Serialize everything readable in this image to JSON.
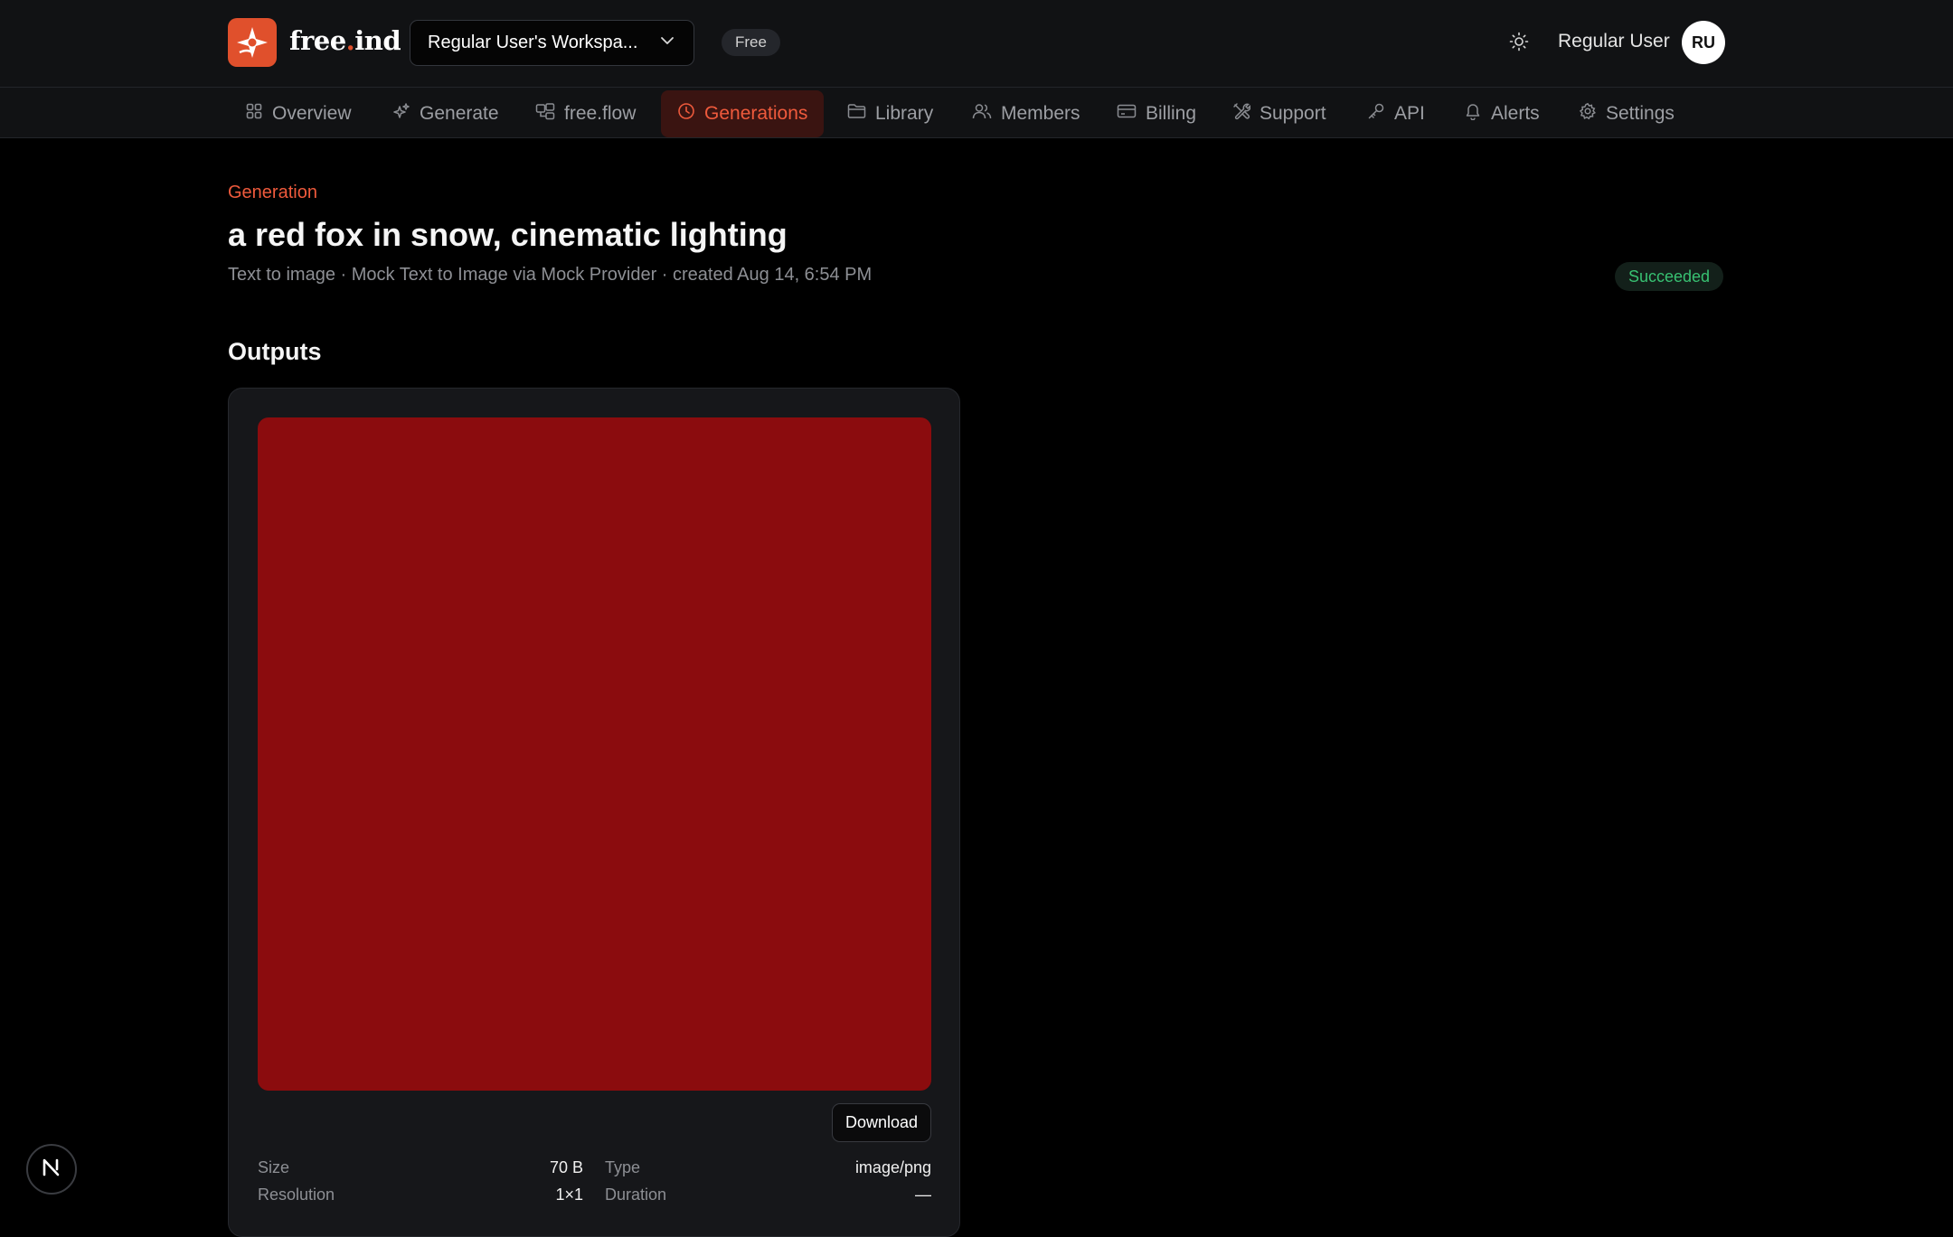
{
  "brand": {
    "name_main": "free",
    "name_dot": ".",
    "name_tail": "ind",
    "accent": "#e0502c"
  },
  "header": {
    "workspace": "Regular User's Workspa...",
    "plan": "Free",
    "user_name": "Regular User",
    "avatar_initials": "RU"
  },
  "nav": {
    "items": [
      {
        "label": "Overview",
        "icon": "grid-icon"
      },
      {
        "label": "Generate",
        "icon": "sparkles-icon"
      },
      {
        "label": "free.flow",
        "icon": "flow-icon"
      },
      {
        "label": "Generations",
        "icon": "clock-icon",
        "active": true
      },
      {
        "label": "Library",
        "icon": "folder-icon"
      },
      {
        "label": "Members",
        "icon": "users-icon"
      },
      {
        "label": "Billing",
        "icon": "credit-card-icon"
      },
      {
        "label": "Support",
        "icon": "tools-icon"
      },
      {
        "label": "API",
        "icon": "key-icon"
      },
      {
        "label": "Alerts",
        "icon": "bell-icon"
      },
      {
        "label": "Settings",
        "icon": "gear-icon"
      }
    ]
  },
  "page": {
    "eyebrow": "Generation",
    "title": "a red fox in snow, cinematic lighting",
    "meta": "Text to image · Mock Text to Image via Mock Provider · created Aug 14, 6:54 PM",
    "status": "Succeeded",
    "status_color": "#38c172"
  },
  "outputs": {
    "section_title": "Outputs",
    "preview_color": "#8b0c0e",
    "download_label": "Download",
    "details": {
      "size_label": "Size",
      "size_value": "70 B",
      "type_label": "Type",
      "type_value": "image/png",
      "resolution_label": "Resolution",
      "resolution_value": "1×1",
      "duration_label": "Duration",
      "duration_value": "—"
    }
  },
  "dev_badge": "N"
}
